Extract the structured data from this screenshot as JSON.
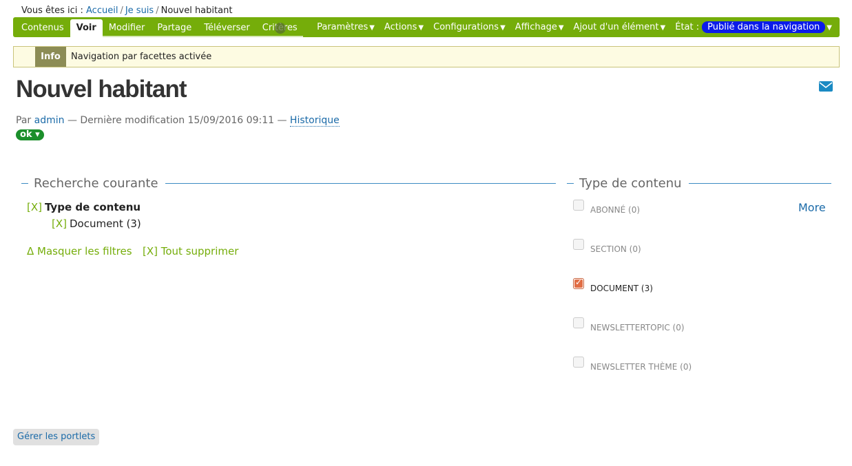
{
  "breadcrumb": {
    "prefix": "Vous êtes ici :",
    "items": [
      "Accueil",
      "Je suis"
    ],
    "current": "Nouvel habitant"
  },
  "toolbar": {
    "tabs": [
      "Contenus",
      "Voir",
      "Modifier",
      "Partage",
      "Téléverser",
      "Critères"
    ],
    "active_tab": "Voir",
    "menus": [
      "Paramètres",
      "Actions",
      "Configurations",
      "Affichage",
      "Ajout d'un élément"
    ],
    "state_label": "État :",
    "state_value": "Publié dans la navigation",
    "arrow": "▼"
  },
  "info": {
    "label": "Info",
    "text": "Navigation par facettes activée"
  },
  "page": {
    "title": "Nouvel habitant",
    "by": "Par",
    "author": "admin",
    "modified": "— Dernière modification 15/09/2016 09:11 —",
    "history": "Historique",
    "ok": "ok ▾"
  },
  "current_search": {
    "legend": "Recherche courante",
    "facet_x": "[X]",
    "facet_title": "Type de contenu",
    "item_x": "[X]",
    "item": "Document (3)",
    "hide_filters": "Δ Masquer les filtres",
    "remove_all": "[X] Tout supprimer"
  },
  "content_type": {
    "legend": "Type de contenu",
    "more": "More",
    "options": [
      {
        "label": "ABONNÉ (0)",
        "checked": false
      },
      {
        "label": "SECTION (0)",
        "checked": false
      },
      {
        "label": "DOCUMENT (3)",
        "checked": true
      },
      {
        "label": "NEWSLETTERTOPIC (0)",
        "checked": false
      },
      {
        "label": "NEWSLETTER THÈME (0)",
        "checked": false
      }
    ]
  },
  "footer": {
    "manage_portlets": "Gérer les portlets"
  },
  "colors": {
    "toolbar": "#75ad0a",
    "link": "#1a6aa8",
    "state_badge": "#0b1bea",
    "ok": "#1b8f2b"
  }
}
